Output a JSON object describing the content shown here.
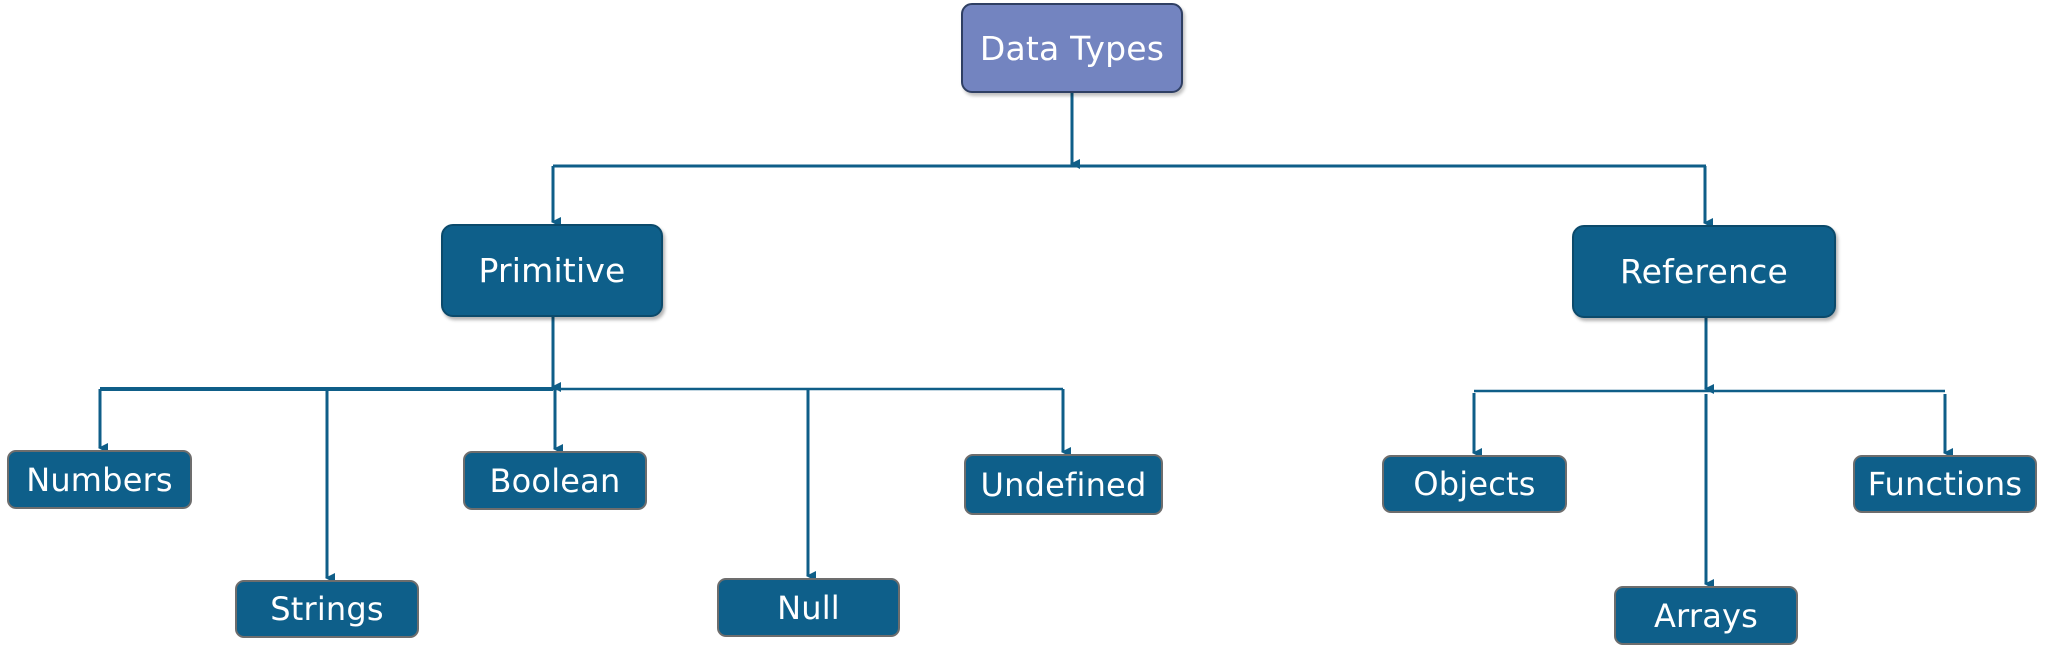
{
  "diagram": {
    "type": "tree",
    "root": {
      "id": "data-types",
      "label": "Data Types",
      "color": "#7384c0"
    },
    "categories": [
      {
        "id": "primitive",
        "label": "Primitive",
        "color": "#0e5f8a",
        "children": [
          {
            "id": "numbers",
            "label": "Numbers"
          },
          {
            "id": "strings",
            "label": "Strings"
          },
          {
            "id": "boolean",
            "label": "Boolean"
          },
          {
            "id": "null",
            "label": "Null"
          },
          {
            "id": "undefined",
            "label": "Undefined"
          }
        ]
      },
      {
        "id": "reference",
        "label": "Reference",
        "color": "#0e5f8a",
        "children": [
          {
            "id": "objects",
            "label": "Objects"
          },
          {
            "id": "arrays",
            "label": "Arrays"
          },
          {
            "id": "functions",
            "label": "Functions"
          }
        ]
      }
    ],
    "edges": [
      [
        "data-types",
        "primitive"
      ],
      [
        "data-types",
        "reference"
      ],
      [
        "primitive",
        "numbers"
      ],
      [
        "primitive",
        "strings"
      ],
      [
        "primitive",
        "boolean"
      ],
      [
        "primitive",
        "null"
      ],
      [
        "primitive",
        "undefined"
      ],
      [
        "reference",
        "objects"
      ],
      [
        "reference",
        "arrays"
      ],
      [
        "reference",
        "functions"
      ]
    ],
    "connector_color": "#0f5e88"
  }
}
